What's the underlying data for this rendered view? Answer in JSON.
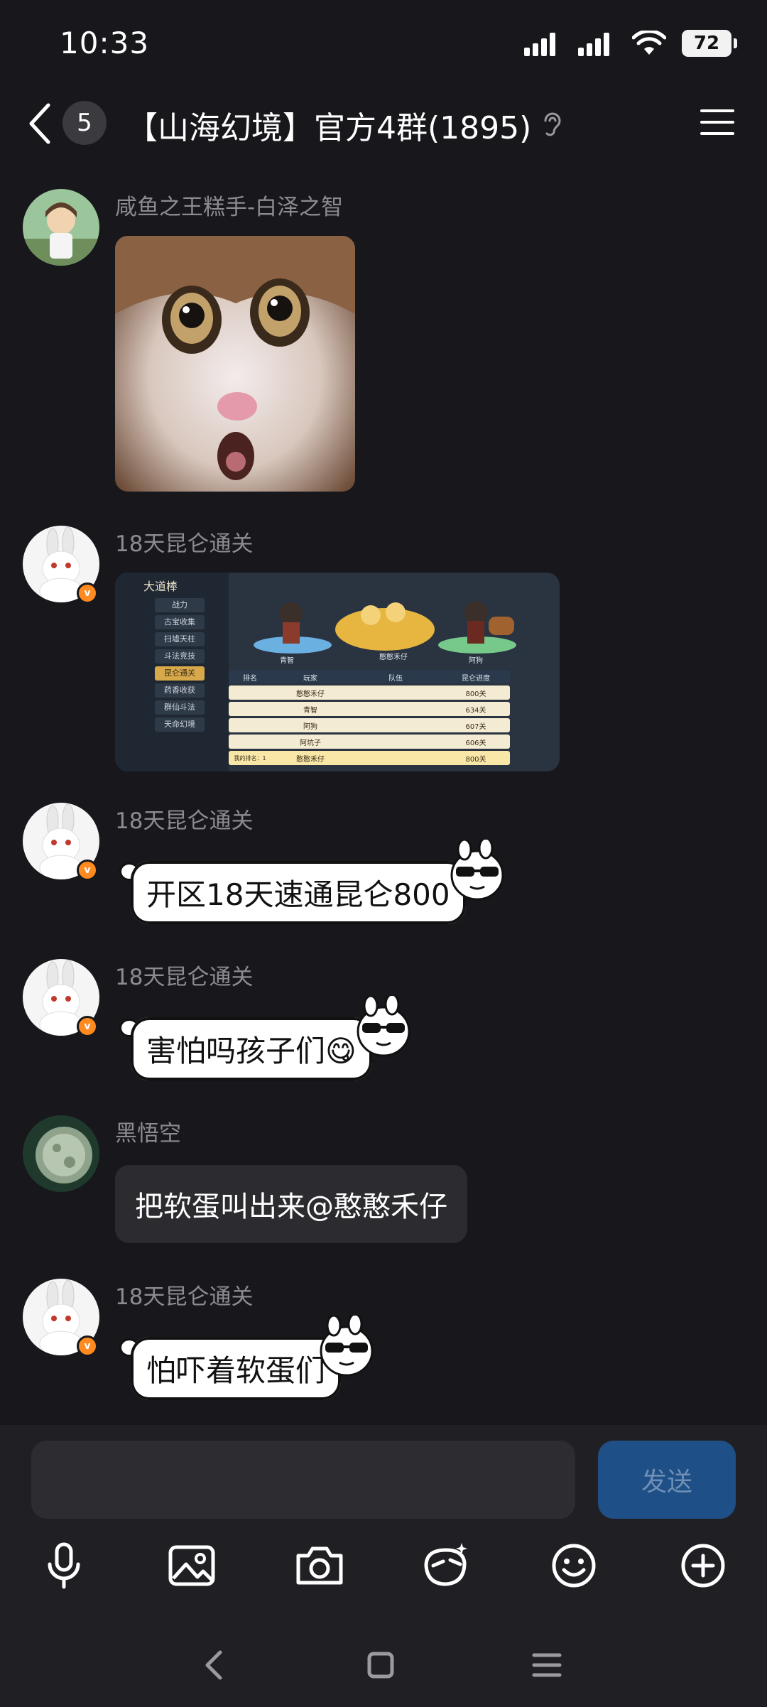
{
  "status": {
    "time": "10:33",
    "battery": "72"
  },
  "header": {
    "unread_count": "5",
    "title": "【山海幻境】官方4群(1895)"
  },
  "messages": [
    {
      "sender": "咸鱼之王糕手-白泽之智",
      "type": "image",
      "image": "shocked-cat-meme"
    },
    {
      "sender": "18天昆仑通关",
      "type": "image",
      "image": "game-ranking-screenshot"
    },
    {
      "sender": "18天昆仑通关",
      "type": "sticker-text",
      "text": "开区18天速通昆仑800"
    },
    {
      "sender": "18天昆仑通关",
      "type": "sticker-text",
      "text": "害怕吗孩子们😋"
    },
    {
      "sender": "黑悟空",
      "type": "text",
      "text": "把软蛋叫出来@憨憨禾仔"
    },
    {
      "sender": "18天昆仑通关",
      "type": "sticker-text",
      "text": "怕吓着软蛋们"
    }
  ],
  "game_screenshot": {
    "title": "大道棒",
    "menu": [
      "战力",
      "古宝收集",
      "扫墟天柱",
      "斗法竞技",
      "昆仑通关",
      "药香收获",
      "群仙斗法",
      "天命幻境"
    ],
    "podium": [
      "青智",
      "憨憨禾仔",
      "阿狗"
    ],
    "headers": [
      "排名",
      "玩家",
      "队伍",
      "昆仑进度"
    ],
    "rows": [
      {
        "player": "憨憨禾仔",
        "progress": "800关"
      },
      {
        "player": "青智",
        "progress": "634关"
      },
      {
        "player": "阿狗",
        "progress": "607关"
      },
      {
        "player": "阿坑子",
        "progress": "606关"
      },
      {
        "player": "憨憨禾仔",
        "progress": "800关"
      }
    ],
    "my_rank_label": "我的排名：1"
  },
  "input": {
    "send_label": "发送"
  },
  "colors": {
    "background": "#17171c",
    "bubble": "#2b2b30",
    "send": "#1e4f86",
    "badge": "#ff8a1f"
  }
}
